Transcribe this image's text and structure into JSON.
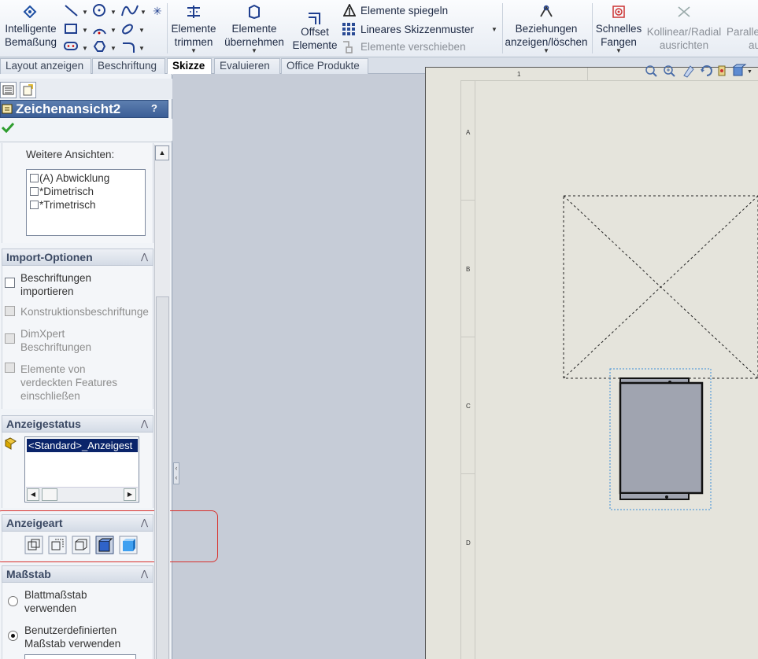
{
  "ribbon": {
    "smart_dim": [
      "Intelligente",
      "Bemaßung"
    ],
    "trim": [
      "Elemente",
      "trimmen"
    ],
    "convert": [
      "Elemente",
      "übernehmen"
    ],
    "offset": [
      "Offset",
      "Elemente"
    ],
    "mirror": "Elemente spiegeln",
    "linear_pattern": "Lineares Skizzenmuster",
    "move": "Elemente verschieben",
    "relations": [
      "Beziehungen",
      "anzeigen/löschen"
    ],
    "snaps": [
      "Schnelles",
      "Fangen"
    ],
    "align": [
      "Kollinear/Radial",
      "ausrichten"
    ],
    "parallel": [
      "Parallel",
      "au"
    ]
  },
  "tabs": [
    "Layout anzeigen",
    "Beschriftung",
    "Skizze",
    "Evaluieren",
    "Office Produkte"
  ],
  "active_tab": "Skizze",
  "pm": {
    "title": "Zeichenansicht2",
    "help": "?",
    "more_views_label": "Weitere Ansichten:",
    "more_views": [
      "(A) Abwicklung",
      "*Dimetrisch",
      "*Trimetrisch"
    ],
    "import": {
      "title": "Import-Optionen",
      "opt1": [
        "Beschriftungen",
        "importieren"
      ],
      "opt2": "Konstruktionsbeschriftunge",
      "opt3": [
        "DimXpert",
        "Beschriftungen"
      ],
      "opt4": [
        "Elemente von",
        "verdeckten Features",
        "einschließen"
      ]
    },
    "display_state": {
      "title": "Anzeigestatus",
      "item": "<Standard>_Anzeigest"
    },
    "display_style": {
      "title": "Anzeigeart"
    },
    "scale": {
      "title": "Maßstab",
      "opt1": [
        "Blattmaßstab",
        "verwenden"
      ],
      "opt2": [
        "Benutzerdefinierten",
        "Maßstab verwenden"
      ]
    }
  },
  "sheet": {
    "top_zone": "1",
    "rows": [
      "A",
      "B",
      "C",
      "D"
    ]
  }
}
